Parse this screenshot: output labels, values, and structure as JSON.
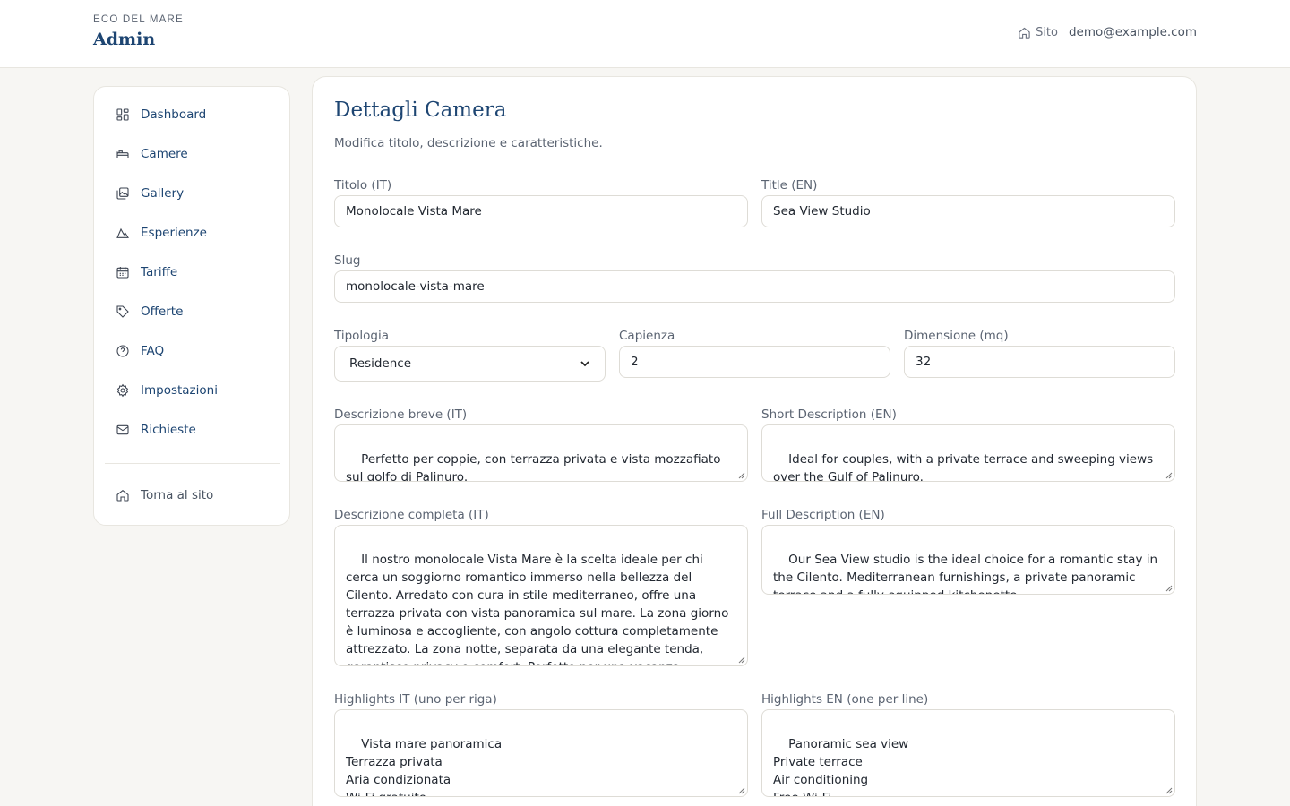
{
  "header": {
    "brand_kicker": "ECO DEL MARE",
    "brand_title": "Admin",
    "site_link": "Sito",
    "user_email": "demo@example.com"
  },
  "sidebar": {
    "items": [
      {
        "label": "Dashboard",
        "icon": "dashboard-icon"
      },
      {
        "label": "Camere",
        "icon": "bed-icon"
      },
      {
        "label": "Gallery",
        "icon": "gallery-icon"
      },
      {
        "label": "Esperienze",
        "icon": "mountain-icon"
      },
      {
        "label": "Tariffe",
        "icon": "calendar-icon"
      },
      {
        "label": "Offerte",
        "icon": "tag-icon"
      },
      {
        "label": "FAQ",
        "icon": "help-circle-icon"
      },
      {
        "label": "Impostazioni",
        "icon": "gear-icon"
      },
      {
        "label": "Richieste",
        "icon": "mail-icon"
      }
    ],
    "back_label": "Torna al sito"
  },
  "form": {
    "title": "Dettagli Camera",
    "subtitle": "Modifica titolo, descrizione e caratteristiche.",
    "title_it": {
      "label": "Titolo (IT)",
      "value": "Monolocale Vista Mare"
    },
    "title_en": {
      "label": "Title (EN)",
      "value": "Sea View Studio"
    },
    "slug": {
      "label": "Slug",
      "value": "monolocale-vista-mare"
    },
    "tipologia": {
      "label": "Tipologia",
      "value": "Residence"
    },
    "capienza": {
      "label": "Capienza",
      "value": "2"
    },
    "dimensione": {
      "label": "Dimensione (mq)",
      "value": "32"
    },
    "short_it": {
      "label": "Descrizione breve (IT)",
      "value": "Perfetto per coppie, con terrazza privata e vista mozzafiato sul golfo di Palinuro."
    },
    "short_en": {
      "label": "Short Description (EN)",
      "value": "Ideal for couples, with a private terrace and sweeping views over the Gulf of Palinuro."
    },
    "full_it": {
      "label": "Descrizione completa (IT)",
      "value": "Il nostro monolocale Vista Mare è la scelta ideale per chi cerca un soggiorno romantico immerso nella bellezza del Cilento. Arredato con cura in stile mediterraneo, offre una terrazza privata con vista panoramica sul mare. La zona giorno è luminosa e accogliente, con angolo cottura completamente attrezzato. La zona notte, separata da una elegante tenda, garantisce privacy e comfort. Perfetto per una vacanza all’insegna del relax e della tranquillità."
    },
    "full_en": {
      "label": "Full Description (EN)",
      "value": "Our Sea View studio is the ideal choice for a romantic stay in the Cilento. Mediterranean furnishings, a private panoramic terrace and a fully equipped kitchenette."
    },
    "highlights_it": {
      "label": "Highlights IT (uno per riga)",
      "value": "Vista mare panoramica\nTerrazza privata\nAria condizionata\nWi-Fi gratuito"
    },
    "highlights_en": {
      "label": "Highlights EN (one per line)",
      "value": "Panoramic sea view\nPrivate terrace\nAir conditioning\nFree Wi-Fi"
    }
  }
}
